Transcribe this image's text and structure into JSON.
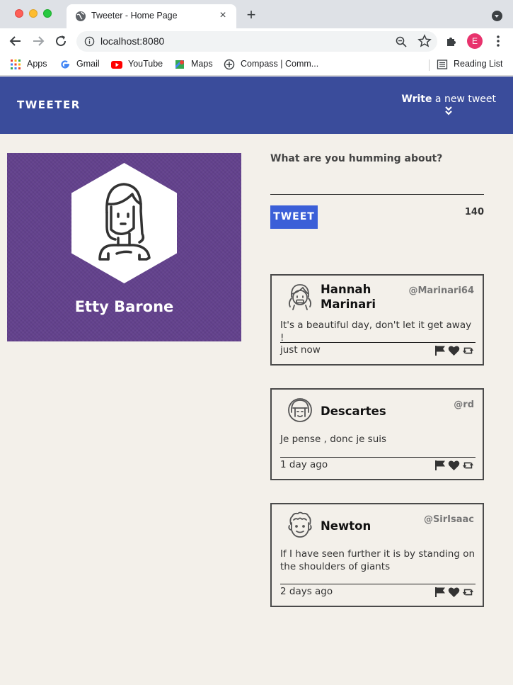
{
  "browser": {
    "tab_title": "Tweeter - Home Page",
    "tab_close": "×",
    "new_tab": "+",
    "url": "localhost:8080",
    "profile_initial": "E",
    "bookmarks": [
      {
        "label": "Apps",
        "icon": "apps-grid-icon"
      },
      {
        "label": "Gmail",
        "icon": "google-icon"
      },
      {
        "label": "YouTube",
        "icon": "youtube-icon"
      },
      {
        "label": "Maps",
        "icon": "maps-icon"
      },
      {
        "label": "Compass | Comm...",
        "icon": "compass-icon"
      }
    ],
    "reading_list": "Reading List"
  },
  "nav": {
    "brand": "TWEETER",
    "compose_bold": "Write",
    "compose_rest": " a new tweet"
  },
  "profile": {
    "name": "Etty Barone"
  },
  "composer": {
    "prompt": "What are you humming about?",
    "button_label": "TWEET",
    "counter": "140"
  },
  "tweets": [
    {
      "name": "Hannah Marinari",
      "handle": "@Marinari64",
      "content": "It's a beautiful day, don't let it get away !",
      "time": "just now"
    },
    {
      "name": "Descartes",
      "handle": "@rd",
      "content": "Je pense , donc je suis",
      "time": "1 day ago"
    },
    {
      "name": "Newton",
      "handle": "@SirIsaac",
      "content": "If I have seen further it is by standing on the shoulders of giants",
      "time": "2 days ago"
    }
  ],
  "colors": {
    "nav": "#3a4c9b",
    "profile_bg": "#63418d",
    "tweet_button": "#3b5fd8",
    "page_bg": "#f3f0ea"
  }
}
